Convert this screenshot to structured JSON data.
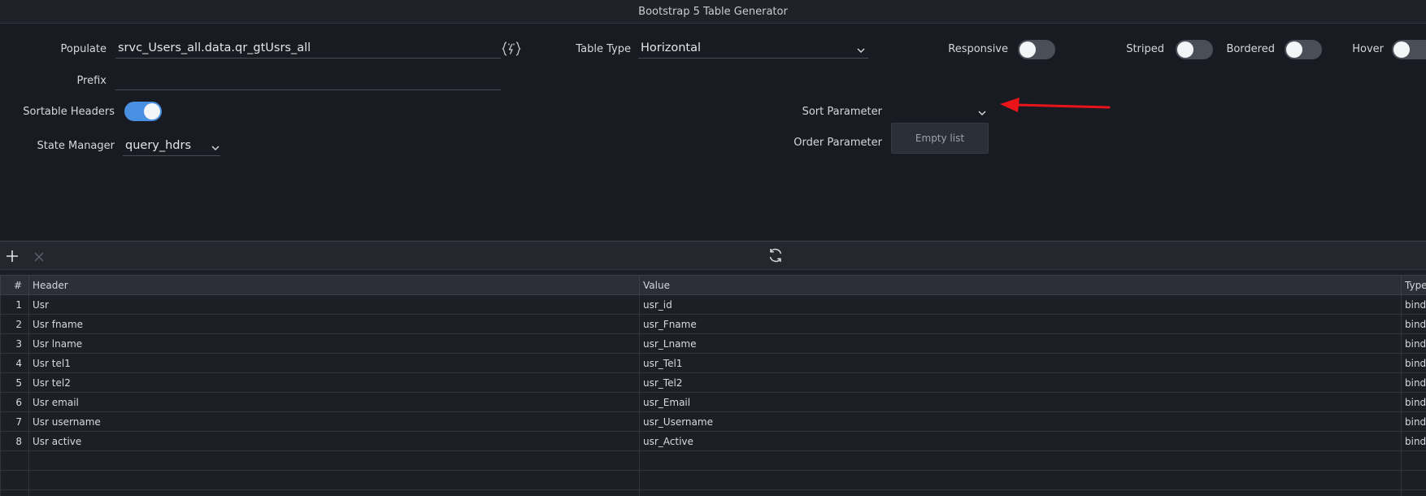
{
  "window": {
    "title": "Bootstrap 5 Table Generator"
  },
  "settings": {
    "populate": {
      "label": "Populate",
      "value": "srvc_Users_all.data.qr_gtUsrs_all",
      "icon": "data-binding-icon"
    },
    "prefix": {
      "label": "Prefix",
      "value": ""
    },
    "sortable_headers": {
      "label": "Sortable Headers",
      "on": true
    },
    "state_manager": {
      "label": "State Manager",
      "value": "query_hdrs"
    },
    "table_type": {
      "label": "Table Type",
      "value": "Horizontal"
    },
    "sort_parameter": {
      "label": "Sort Parameter",
      "value": ""
    },
    "order_parameter": {
      "label": "Order Parameter"
    },
    "dropdown_empty_text": "Empty list",
    "responsive": {
      "label": "Responsive",
      "on": false
    },
    "striped": {
      "label": "Striped",
      "on": false
    },
    "bordered": {
      "label": "Bordered",
      "on": false
    },
    "hover": {
      "label": "Hover",
      "on": false
    }
  },
  "annotation": {
    "color": "#e8141a",
    "shape": "arrow"
  },
  "toolbar": {
    "add_icon": "plus-icon",
    "delete_icon": "close-icon",
    "refresh_icon": "refresh-icon"
  },
  "grid": {
    "columns": [
      "#",
      "Header",
      "Value",
      "Type"
    ],
    "rows": [
      [
        "1",
        "Usr",
        "usr_id",
        "bind"
      ],
      [
        "2",
        "Usr fname",
        "usr_Fname",
        "bind"
      ],
      [
        "3",
        "Usr lname",
        "usr_Lname",
        "bind"
      ],
      [
        "4",
        "Usr tel1",
        "usr_Tel1",
        "bind"
      ],
      [
        "5",
        "Usr tel2",
        "usr_Tel2",
        "bind"
      ],
      [
        "6",
        "Usr email",
        "usr_Email",
        "bind"
      ],
      [
        "7",
        "Usr username",
        "usr_Username",
        "bind"
      ],
      [
        "8",
        "Usr active",
        "usr_Active",
        "bind"
      ]
    ]
  },
  "colors": {
    "background": "#181b22",
    "accent": "#4a90e2",
    "toggle_off": "#4a4e57"
  }
}
